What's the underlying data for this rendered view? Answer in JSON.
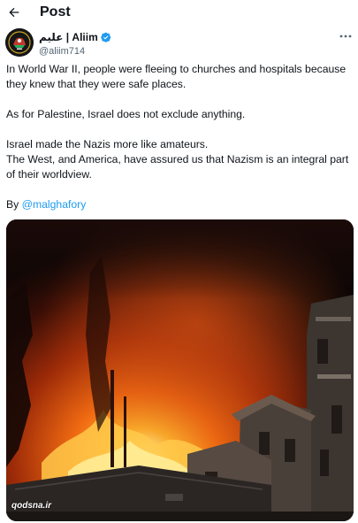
{
  "header": {
    "title": "Post",
    "back_icon": "arrow-left-icon"
  },
  "author": {
    "display_name": "عليم | Aliim",
    "handle": "@aliim714",
    "verified": true,
    "verified_color": "#1d9bf0",
    "more_icon": "more-horizontal-icon"
  },
  "tweet": {
    "p1": "In World War II, people were fleeing to churches and hospitals because they knew that they were safe places.",
    "p2": "As for Palestine, Israel does not exclude anything.",
    "p3_line1": "Israel made the Nazis more like amateurs.",
    "p3_line2": "The West, and America, have assured us that Nazism is an integral part of their worldview.",
    "by_label": "By",
    "by_mention": "@malghafory"
  },
  "media": {
    "watermark": "qodsna.ir"
  },
  "colors": {
    "text": "#0f1419",
    "secondary": "#536471",
    "link": "#1d9bf0"
  }
}
